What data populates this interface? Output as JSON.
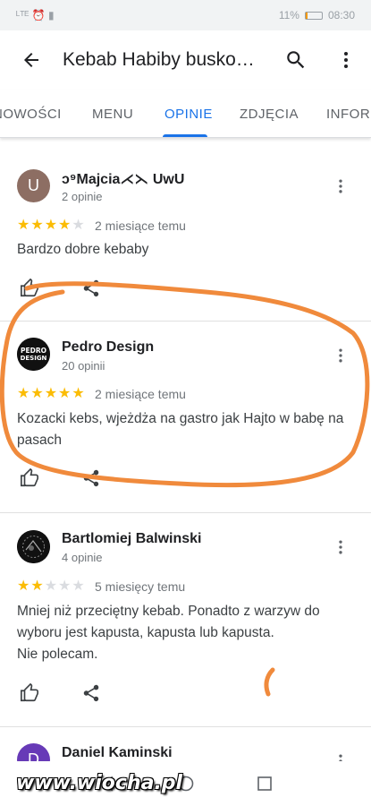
{
  "status_bar": {
    "left_icons": "ᴸᵀᴱ ⏰ ▮",
    "battery": "11%",
    "time": "08:30",
    "battery_level": 0.11,
    "battery_color": "#f29900"
  },
  "app_bar": {
    "title": "Kebab Habiby busko…"
  },
  "tabs": [
    {
      "label": "NOWOŚCI",
      "active": false
    },
    {
      "label": "MENU",
      "active": false
    },
    {
      "label": "OPINIE",
      "active": true
    },
    {
      "label": "ZDJĘCIA",
      "active": false
    },
    {
      "label": "INFORM",
      "active": false
    }
  ],
  "reviews": [
    {
      "author": "ↄ⁹Majcia⋌⋋ UwU",
      "count": "2 opinie",
      "avatar_letter": "U",
      "avatar_color": "#8d6e63",
      "rating": 4,
      "time": "2 miesiące temu",
      "text": "Bardzo dobre kebaby"
    },
    {
      "author": "Pedro Design",
      "count": "20 opinii",
      "avatar_text": "PEDRO DESIGN",
      "avatar_color": "#111111",
      "rating": 5,
      "time": "2 miesiące temu",
      "text": "Kozacki kebs, wjeżdża na gastro jak Hajto w babę na pasach"
    },
    {
      "author": "Bartlomiej Balwinski",
      "count": "4 opinie",
      "avatar_color": "#111111",
      "rating": 2,
      "time": "5 miesięcy temu",
      "text": "Mniej niż przeciętny kebab. Ponadto z warzyw do wyboru jest kapusta, kapusta lub kapusta.\nNie polecam."
    },
    {
      "author": "Daniel Kaminski",
      "avatar_letter": "D",
      "avatar_color": "#673ab7"
    }
  ],
  "watermark": "www.wiocha.pl",
  "colors": {
    "accent": "#1a73e8",
    "star": "#fbbc04",
    "annotation": "#f08a3c"
  }
}
